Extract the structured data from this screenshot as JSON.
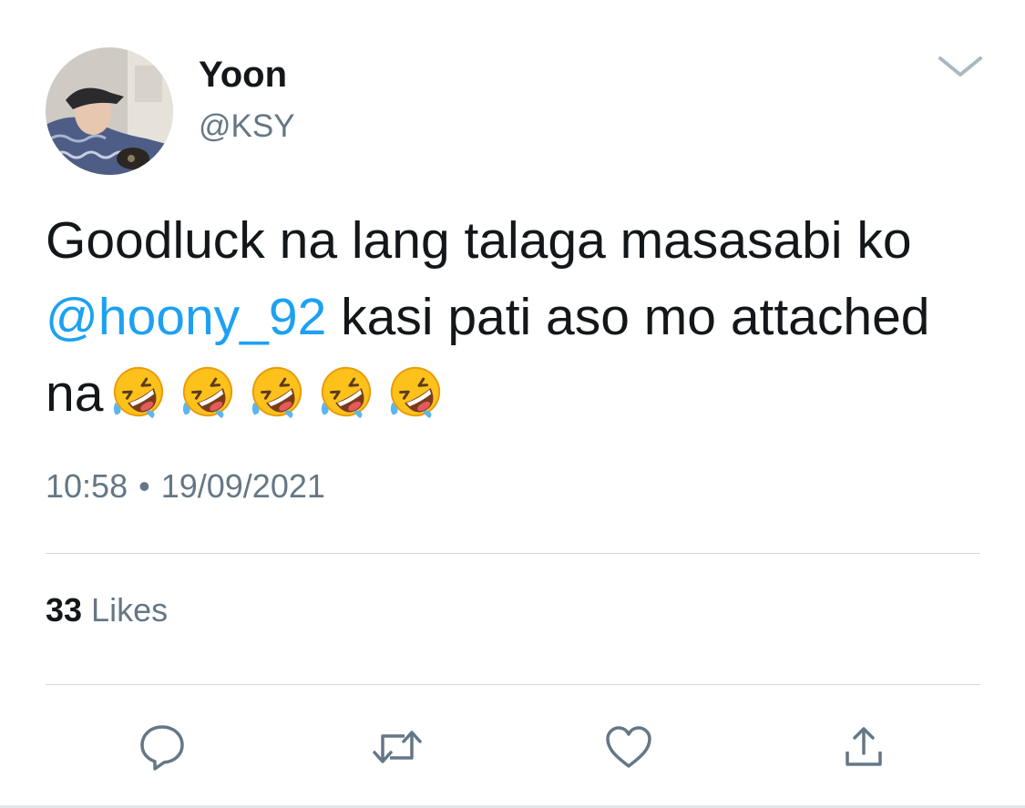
{
  "tweet": {
    "author": {
      "display_name": "Yoon",
      "handle": "@KSY",
      "avatar_icon": "user-avatar-photo"
    },
    "text": {
      "before_mention": "Goodluck na lang talaga masasabi ko ",
      "mention": "@hoony_92",
      "after_mention": " kasi pati aso mo attached na",
      "emoji": "rolling-on-the-floor-laughing",
      "emoji_count": 5
    },
    "time": "10:58",
    "separator": "•",
    "date": "19/09/2021",
    "likes": {
      "count": "33",
      "label": "Likes"
    },
    "actions": [
      {
        "name": "reply",
        "icon": "speech-bubble-icon"
      },
      {
        "name": "retweet",
        "icon": "retweet-arrows-icon"
      },
      {
        "name": "like",
        "icon": "heart-icon"
      },
      {
        "name": "share",
        "icon": "share-upload-icon"
      }
    ]
  },
  "colors": {
    "text": "#14171a",
    "secondary": "#657786",
    "link": "#1da1f2",
    "divider": "#d4d8dc"
  }
}
